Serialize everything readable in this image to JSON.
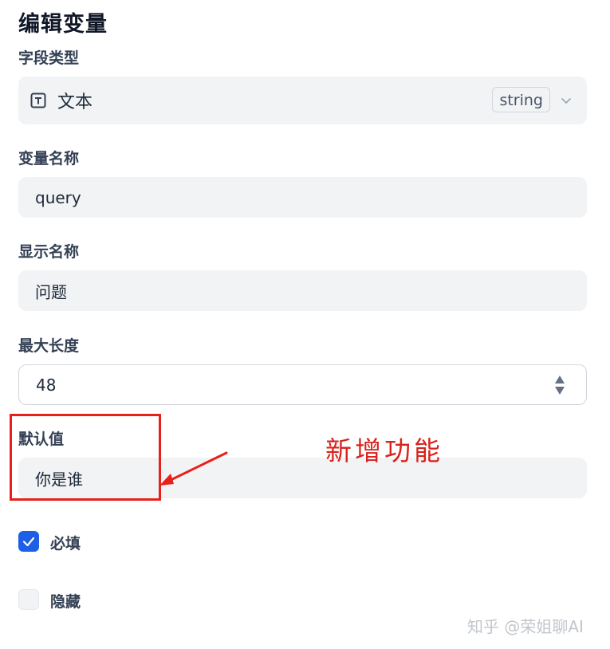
{
  "dialog": {
    "title": "编辑变量"
  },
  "field_type": {
    "label": "字段类型",
    "value": "文本",
    "badge": "string",
    "icon": "text-type-icon"
  },
  "variable_name": {
    "label": "变量名称",
    "value": "query"
  },
  "display_name": {
    "label": "显示名称",
    "value": "问题"
  },
  "max_length": {
    "label": "最大长度",
    "value": "48"
  },
  "default_value": {
    "label": "默认值",
    "value": "你是谁"
  },
  "required": {
    "label": "必填",
    "checked": true
  },
  "hidden": {
    "label": "隐藏",
    "checked": false
  },
  "annotation": {
    "text": "新增功能",
    "color": "#e8201a"
  },
  "watermark": {
    "text": "知乎 @荣姐聊AI"
  },
  "colors": {
    "accent": "#1d5fe5",
    "field_bg": "#f2f3f5"
  }
}
